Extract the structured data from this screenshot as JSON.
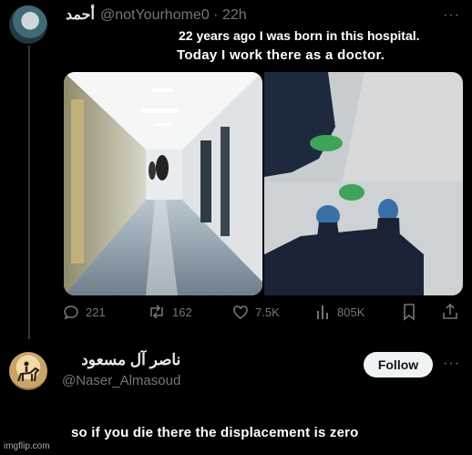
{
  "post": {
    "author_name": "أحمد",
    "handle": "@notYourhome0",
    "separator": "·",
    "time": "22h",
    "more_label": "···"
  },
  "meme": {
    "caption_top_1": "22 years ago I was born in this hospital.",
    "caption_top_2": "Today I work there as a doctor.",
    "caption_bottom": "so if you die there the displacement is zero"
  },
  "actions": {
    "replies": "221",
    "reposts": "162",
    "likes": "7.5K",
    "views": "805K"
  },
  "reply_user": {
    "name": "ناصر آل مسعود",
    "handle": "@Naser_Almasoud",
    "follow_label": "Follow",
    "more_label": "···"
  },
  "watermark": "imgflip.com",
  "colors": {
    "background": "#000000",
    "text": "#e7e9ea",
    "secondary_text": "#71767b",
    "follow_bg": "#eff3f4"
  }
}
